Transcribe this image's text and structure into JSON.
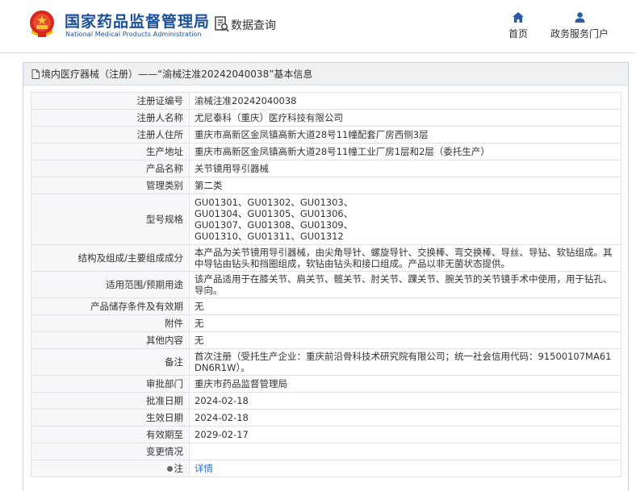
{
  "header": {
    "logo_cn": "国家药品监督管理局",
    "logo_en": "National Medical Products Administration",
    "query_label": "数据查询",
    "nav": [
      {
        "label": "首页",
        "icon": "home-icon"
      },
      {
        "label": "政务服务门户",
        "icon": "user-icon"
      }
    ]
  },
  "colors": {
    "brand": "#1a4f9c",
    "link": "#2a6fc9"
  },
  "panel": {
    "title": "境内医疗器械（注册）——“渝械注准20242040038”基本信息"
  },
  "record": {
    "rows": [
      {
        "key": "注册证编号",
        "value": "渝械注准20242040038"
      },
      {
        "key": "注册人名称",
        "value": "尤尼泰科（重庆）医疗科技有限公司"
      },
      {
        "key": "注册人住所",
        "value": "重庆市高新区金凤镇高新大道28号11幢配套厂房西侧3层"
      },
      {
        "key": "生产地址",
        "value": "重庆市高新区金凤镇高新大道28号11幢工业厂房1层和2层（委托生产）"
      },
      {
        "key": "产品名称",
        "value": "关节镜用导引器械"
      },
      {
        "key": "管理类别",
        "value": "第二类"
      },
      {
        "key": "型号规格",
        "value_lines": [
          "GU01301、GU01302、GU01303、",
          "GU01304、GU01305、GU01306、",
          "GU01307、GU01308、GU01309、",
          "GU01310、GU01311、GU01312"
        ]
      },
      {
        "key": "结构及组成/主要组成成分",
        "value": "本产品为关节镜用导引器械，由尖角导针、螺旋导针、交换棒、弯交换棒、导丝、导钻、软钻组成。其中导钻由钻头和挡圈组成，软钻由钻头和接口组成。产品以非无菌状态提供。"
      },
      {
        "key": "适用范围/预期用途",
        "value": "该产品适用于在膝关节、肩关节、髋关节、肘关节、踝关节、腕关节的关节镜手术中使用，用于钻孔、导向。"
      },
      {
        "key": "产品储存条件及有效期",
        "value": "无"
      },
      {
        "key": "附件",
        "value": "无"
      },
      {
        "key": "其他内容",
        "value": "无"
      },
      {
        "key": "备注",
        "value": "首次注册（受托生产企业：重庆前沿骨科技术研究院有限公司；统一社会信用代码：91500107MA61DN6R1W）。"
      },
      {
        "key": "审批部门",
        "value": "重庆市药品监督管理局"
      },
      {
        "key": "批准日期",
        "value": "2024-02-18"
      },
      {
        "key": "生效日期",
        "value": "2024-02-18"
      },
      {
        "key": "有效期至",
        "value": "2029-02-17"
      },
      {
        "key": "变更情况",
        "value": ""
      },
      {
        "key": "注",
        "value": "详情"
      }
    ]
  }
}
